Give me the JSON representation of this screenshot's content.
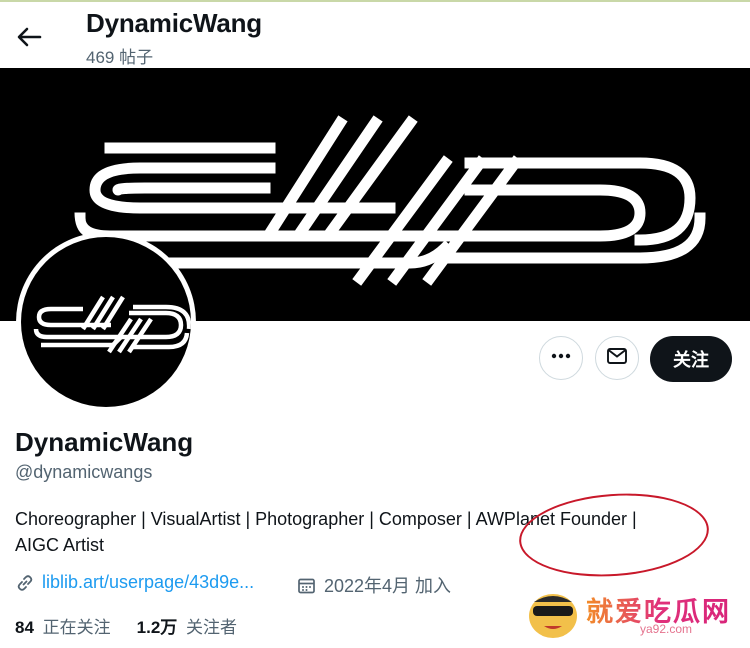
{
  "header": {
    "display_name": "DynamicWang",
    "post_count": "469 帖子"
  },
  "profile": {
    "display_name": "DynamicWang",
    "handle": "@dynamicwangs",
    "bio_line1": "Choreographer | VisualArtist | Photographer | Composer | AWPlanet Founder |",
    "bio_line2": "AIGC Artist",
    "website": "liblib.art/userpage/43d9e...",
    "joined": "2022年4月 加入"
  },
  "actions": {
    "follow_label": "关注"
  },
  "stats": {
    "following_count": "84",
    "following_label": "正在关注",
    "followers_count": "1.2万",
    "followers_label": "关注者"
  },
  "watermark": {
    "text": "就爱吃瓜网",
    "url": "ya92.com"
  },
  "colors": {
    "link": "#1d9bf0",
    "annotation_circle": "#c8182a"
  },
  "icons": [
    "back-arrow-icon",
    "more-icon",
    "mail-icon",
    "link-icon",
    "calendar-icon"
  ]
}
